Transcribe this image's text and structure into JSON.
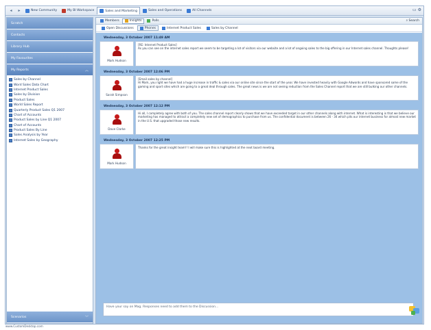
{
  "top_tabs": [
    {
      "label": "New Community",
      "color": "#3a7bd5"
    },
    {
      "label": "My BI Workspace",
      "color": "#c0392b"
    },
    {
      "label": "Sales and Marketing",
      "color": "#3a7bd5",
      "active": true
    },
    {
      "label": "Sales and Operations",
      "color": "#3a7bd5"
    },
    {
      "label": "All Channels",
      "color": "#3a7bd5"
    }
  ],
  "left_panel": {
    "sections_top": [
      "Scratch",
      "Contacts",
      "Library Hub",
      "My Favourites"
    ],
    "open_section": "My Reports",
    "reports": [
      "Sales by Channel",
      "Word Sales Data Chart",
      "Internet Product Sales",
      "Sales by Division",
      "Product Sales",
      "World Sales Report",
      "Quarterly Product Sales Q1 2007",
      "Chart of Accounts",
      "Product Sales by Line Q1 2007",
      "Chart of Accounts",
      "Product Sales By Line",
      "Sales Analysis by Year",
      "Internet Sales by Geography"
    ],
    "bottom_section": "Scenarios"
  },
  "sub_tabs": [
    {
      "label": "Members"
    },
    {
      "label": "Insights",
      "active": true
    },
    {
      "label": "Polls"
    }
  ],
  "sub_tab_right": "Search",
  "breadcrumbs": [
    {
      "label": "Open Discussions"
    },
    {
      "label": "Phones",
      "active": true
    },
    {
      "label": "Internet Product Sales"
    },
    {
      "label": "Sales by Channel"
    }
  ],
  "posts": [
    {
      "date": "Wednesday, 3 October 2007 11:49 AM",
      "author": "Mark Hudson",
      "title": "[RE: Internet Product Sales]",
      "text": "As you can see on the internet sales report we seem to be targeting a lot of visitors via our website and a lot of ongoing sales to the big offering in our Internet sales channel. Thoughts please!"
    },
    {
      "date": "Wednesday, 3 October 2007 12:06 PM",
      "author": "Sarah Simpson",
      "title": "[Email sales by channel]",
      "text": "Hi Mark, you right we have had a huge increase in traffic & sales via our online site since the start of the year. We have invested heavily with Google Adwords and have sponsored some of the gaming and sport sites which are going to a great deal through sales. The great news is we are not seeing reduction from the Sales Channel report that we are still bulking our other channels."
    },
    {
      "date": "Wednesday, 3 October 2007 12:12 PM",
      "author": "Dave Clarke",
      "title": "",
      "text": "Hi all, I completely agree with both of you. The sales channel report clearly shows that we have exceeded target in our other channels along with internet. What is interesting is that we believe our marketing has managed to attract a completely new set of demographics to purchase from us. The confidential document is between 26 - 34 which pits our internet business for almost new market in the U.S. that upgraded those new results."
    },
    {
      "date": "Wednesday, 3 October 2007 12:25 PM",
      "author": "Mark Hudson",
      "title": "",
      "text": "Thanks for the great insight team!! I will make sure this is highlighted at the next board meeting."
    }
  ],
  "reply_placeholder": "Have your say on Mag. Responses need to add them to the Discussion...",
  "status_text": "www.CustomDesktop.com",
  "colors": {
    "accent": "#6b93c8",
    "feed_background": "#9cc0e6",
    "avatar_red": "#c61b1b"
  }
}
